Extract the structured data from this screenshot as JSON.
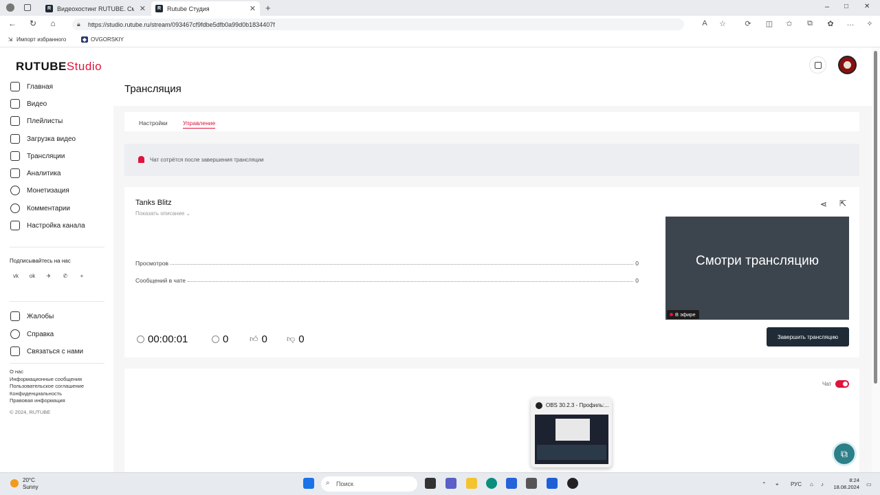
{
  "browser": {
    "tabs": [
      {
        "title": "Видеохостинг RUTUBE. Смотрит",
        "active": false
      },
      {
        "title": "Rutube Студия",
        "active": true
      }
    ],
    "url": "https://studio.rutube.ru/stream/093467cf9fdbe5dfb0a99d0b1834407f",
    "bookmarks": [
      "Импорт избранного",
      "OVGORSKIY"
    ]
  },
  "brand": {
    "name": "RUTUBE",
    "studio": "Studio",
    "accent": "#e0143c"
  },
  "sidebar": {
    "items": [
      {
        "label": "Главная",
        "icon": "home-icon"
      },
      {
        "label": "Видео",
        "icon": "video-icon"
      },
      {
        "label": "Плейлисты",
        "icon": "playlist-icon"
      },
      {
        "label": "Загрузка видео",
        "icon": "upload-icon"
      },
      {
        "label": "Трансляции",
        "icon": "broadcast-icon"
      },
      {
        "label": "Аналитика",
        "icon": "analytics-icon"
      },
      {
        "label": "Монетизация",
        "icon": "money-icon"
      },
      {
        "label": "Комментарии",
        "icon": "comments-icon"
      },
      {
        "label": "Настройка канала",
        "icon": "wand-icon"
      }
    ],
    "follow_title": "Подписывайтесь на нас",
    "social": [
      "vk",
      "ok",
      "telegram",
      "viber",
      "plus"
    ],
    "support": [
      {
        "label": "Жалобы",
        "icon": "flag-icon"
      },
      {
        "label": "Справка",
        "icon": "help-icon"
      },
      {
        "label": "Связаться с нами",
        "icon": "mail-icon"
      }
    ],
    "links": [
      "О нас",
      "Информационные сообщения",
      "Пользовательское соглашение",
      "Конфиденциальность",
      "Правовая информация"
    ],
    "copyright": "© 2024, RUTUBE"
  },
  "page": {
    "title": "Трансляция",
    "tabs": [
      {
        "label": "Настройки",
        "active": false
      },
      {
        "label": "Управление",
        "active": true
      }
    ],
    "notice": "Чат сотрётся после завершения трансляции"
  },
  "stream": {
    "title": "Tanks Blitz",
    "show_description": "Показать описание",
    "stats": [
      {
        "label": "Просмотров",
        "value": "0"
      },
      {
        "label": "Сообщений в чате",
        "value": "0"
      }
    ],
    "preview_text": "Смотри трансляцию",
    "live_badge": "В эфире",
    "timer": "00:00:01",
    "viewers": "0",
    "likes": "0",
    "dislikes": "0",
    "end_button": "Завершить трансляцию"
  },
  "chat": {
    "label": "Чат",
    "enabled": true
  },
  "popup": {
    "title": "OBS 30.2.3 - Профиль:..."
  },
  "taskbar": {
    "weather_temp": "20°C",
    "weather_desc": "Sunny",
    "search_placeholder": "Поиск",
    "lang": "РУС",
    "time": "8:24",
    "date": "18.08.2024"
  }
}
